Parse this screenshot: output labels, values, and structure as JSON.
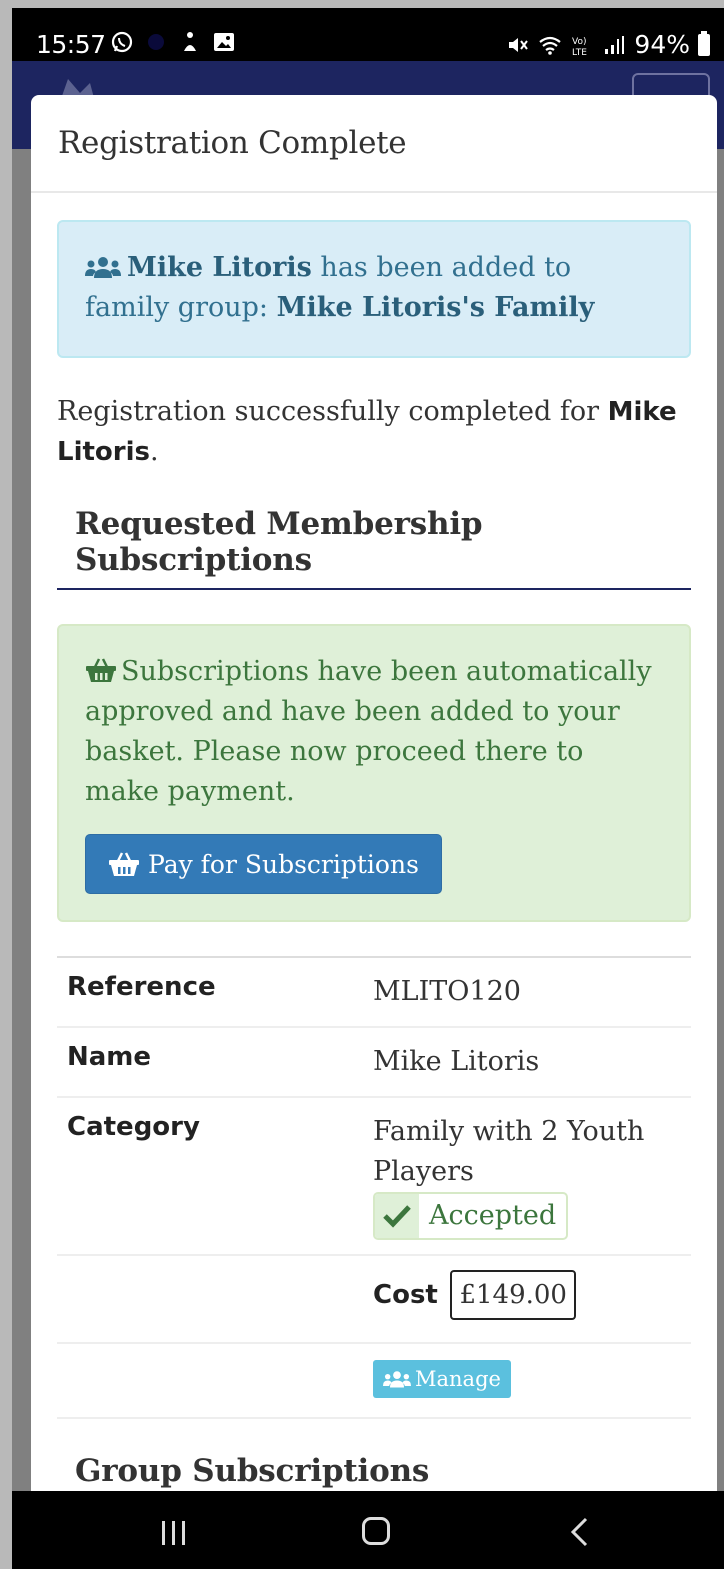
{
  "status_bar": {
    "time": "15:57",
    "battery": "94%",
    "left_icons": [
      "whatsapp-icon",
      "notification-icon",
      "image-icon"
    ],
    "right_icons": [
      "mute-icon",
      "wifi-icon",
      "volte-icon",
      "signal-icon",
      "battery-icon"
    ]
  },
  "modal": {
    "title": "Registration Complete",
    "family_alert": {
      "member_name": "Mike Litoris",
      "text_middle": " has been added to family group: ",
      "group_name": "Mike Litoris's Family"
    },
    "registration": {
      "prefix": "Registration successfully completed for ",
      "name": "Mike Litoris",
      "suffix": "."
    },
    "requested_heading": "Requested Membership Subscriptions",
    "subscription_alert": {
      "text": "Subscriptions have been automatically approved and have been added to your basket. Please now proceed there to make payment.",
      "button_label": "Pay for Subscriptions"
    },
    "details": {
      "reference_label": "Reference",
      "reference_value": "MLITO120",
      "name_label": "Name",
      "name_value": "Mike Litoris",
      "category_label": "Category",
      "category_value": "Family with 2 Youth Players",
      "status": "Accepted",
      "cost_label": "Cost",
      "cost_value": "£149.00",
      "manage_label": "Manage"
    },
    "group_heading": "Group Subscriptions"
  },
  "colors": {
    "header_navy": "#1d2560",
    "info_bg": "#d9edf7",
    "success_bg": "#dff0d8",
    "primary": "#337ab7",
    "manage": "#5bc0de"
  }
}
